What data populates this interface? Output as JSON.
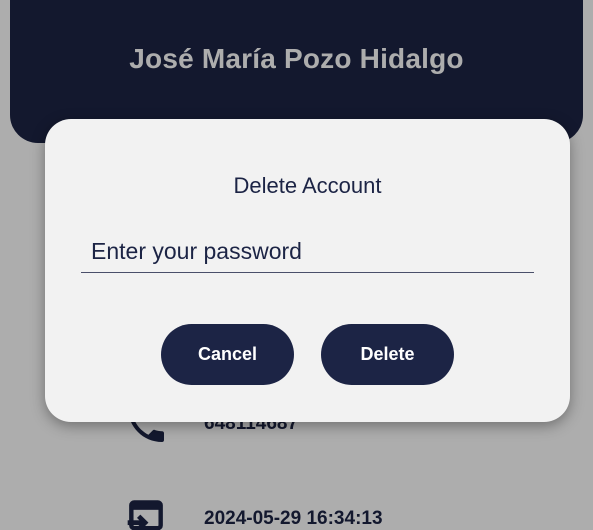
{
  "profile": {
    "name": "José María Pozo Hidalgo",
    "phone": "648114687",
    "date": "2024-05-29 16:34:13"
  },
  "dialog": {
    "title": "Delete Account",
    "password_placeholder": "Enter your password",
    "cancel_label": "Cancel",
    "delete_label": "Delete"
  },
  "colors": {
    "primary": "#1c2445",
    "dialog_bg": "#f2f2f2"
  },
  "icons": {
    "phone": "phone-icon",
    "login": "login-icon"
  }
}
